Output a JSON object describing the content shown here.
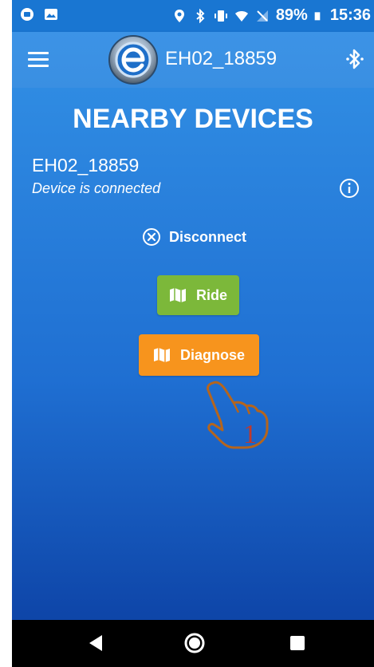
{
  "status_bar": {
    "battery_percent": "89%",
    "time": "15:36"
  },
  "app_bar": {
    "title": "EH02_18859"
  },
  "main": {
    "page_title": "NEARBY DEVICES",
    "device": {
      "name": "EH02_18859",
      "status": "Device is connected"
    },
    "disconnect_label": "Disconnect",
    "ride_label": "Ride",
    "diagnose_label": "Diagnose",
    "annotation_number": "1"
  },
  "colors": {
    "primary": "#2f8be2",
    "ride": "#7cb83a",
    "diagnose": "#f7941d",
    "annotation": "#c0392b"
  }
}
